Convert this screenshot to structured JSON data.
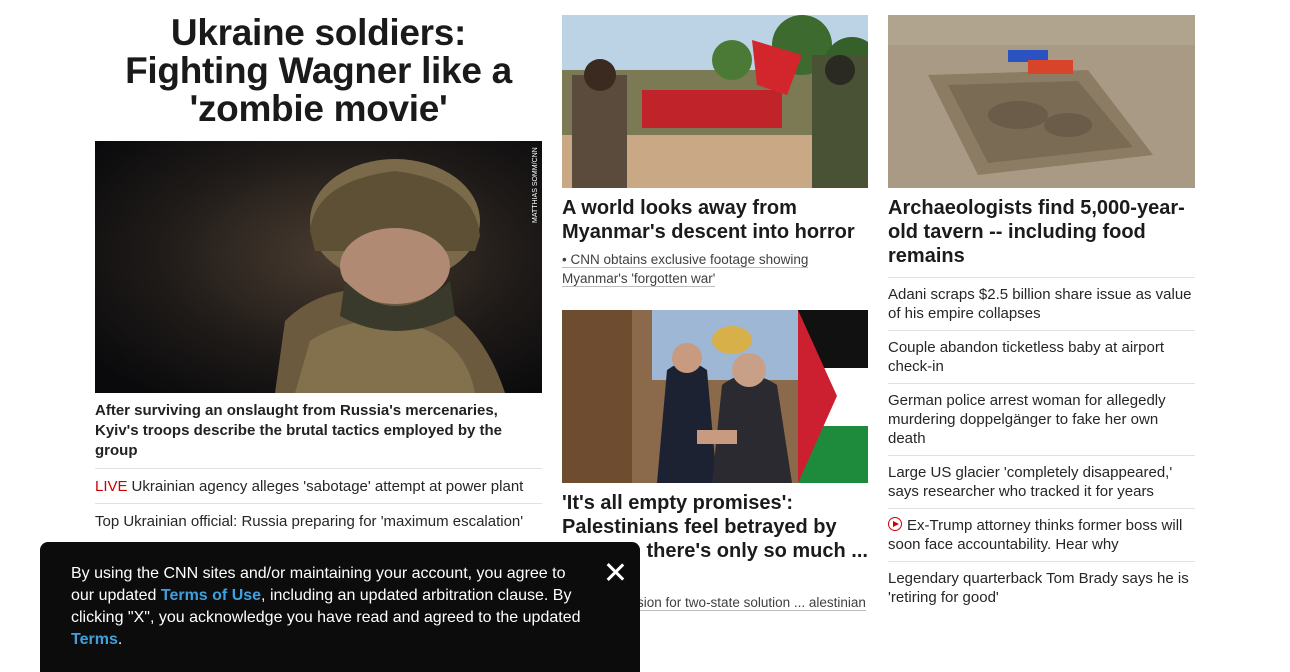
{
  "lead": {
    "headline": "Ukraine soldiers: Fighting Wagner like a 'zombie movie'",
    "photo_credit": "MATTHIAS SOMM/CNN",
    "summary": "After surviving an onslaught from Russia's mercenaries, Kyiv's troops describe the brutal tactics employed by the group",
    "links": [
      {
        "badge": "LIVE",
        "text": "Ukrainian agency alleges 'sabotage' attempt at power plant"
      },
      {
        "badge": "",
        "text": "Top Ukrainian official: Russia preparing for 'maximum escalation'"
      }
    ]
  },
  "middle": {
    "story1": {
      "headline": "A world looks away from Myanmar's descent into horror",
      "sub": "• CNN obtains exclusive footage showing Myanmar's 'forgotten war'"
    },
    "story2": {
      "headline": "'It's all empty promises': Palestinians feel betrayed by US ... en there's only so much ... bear",
      "sub": "... outlines vision for two-state solution ... alestinian sovereignty"
    }
  },
  "right": {
    "headline": "Archaeologists find 5,000-year-old tavern -- including food remains",
    "items": [
      {
        "text": "Adani scraps $2.5 billion share issue as value of his empire collapses",
        "video": false
      },
      {
        "text": "Couple abandon ticketless baby at airport check-in",
        "video": false
      },
      {
        "text": "German police arrest woman for allegedly murdering doppelgänger to fake her own death",
        "video": false
      },
      {
        "text": "Large US glacier 'completely disappeared,' says researcher who tracked it for years",
        "video": false
      },
      {
        "text": "Ex-Trump attorney thinks former boss will soon face accountability. Hear why",
        "video": true
      },
      {
        "text": "Legendary quarterback Tom Brady says he is 'retiring for good'",
        "video": false
      }
    ]
  },
  "cookie": {
    "text_1": "By using the CNN sites and/or maintaining your account, you agree to our updated ",
    "terms_of_use_link": "Terms of Use",
    "text_2": ", including an updated arbitration clause. By clicking \"X\", you acknowledge you have read and agreed to the updated ",
    "terms_link": "Terms",
    "text_3": "."
  },
  "colors": {
    "live_red": "#cc0000",
    "link_blue": "#3fa0e0",
    "banner_bg": "#0c0c0c"
  }
}
